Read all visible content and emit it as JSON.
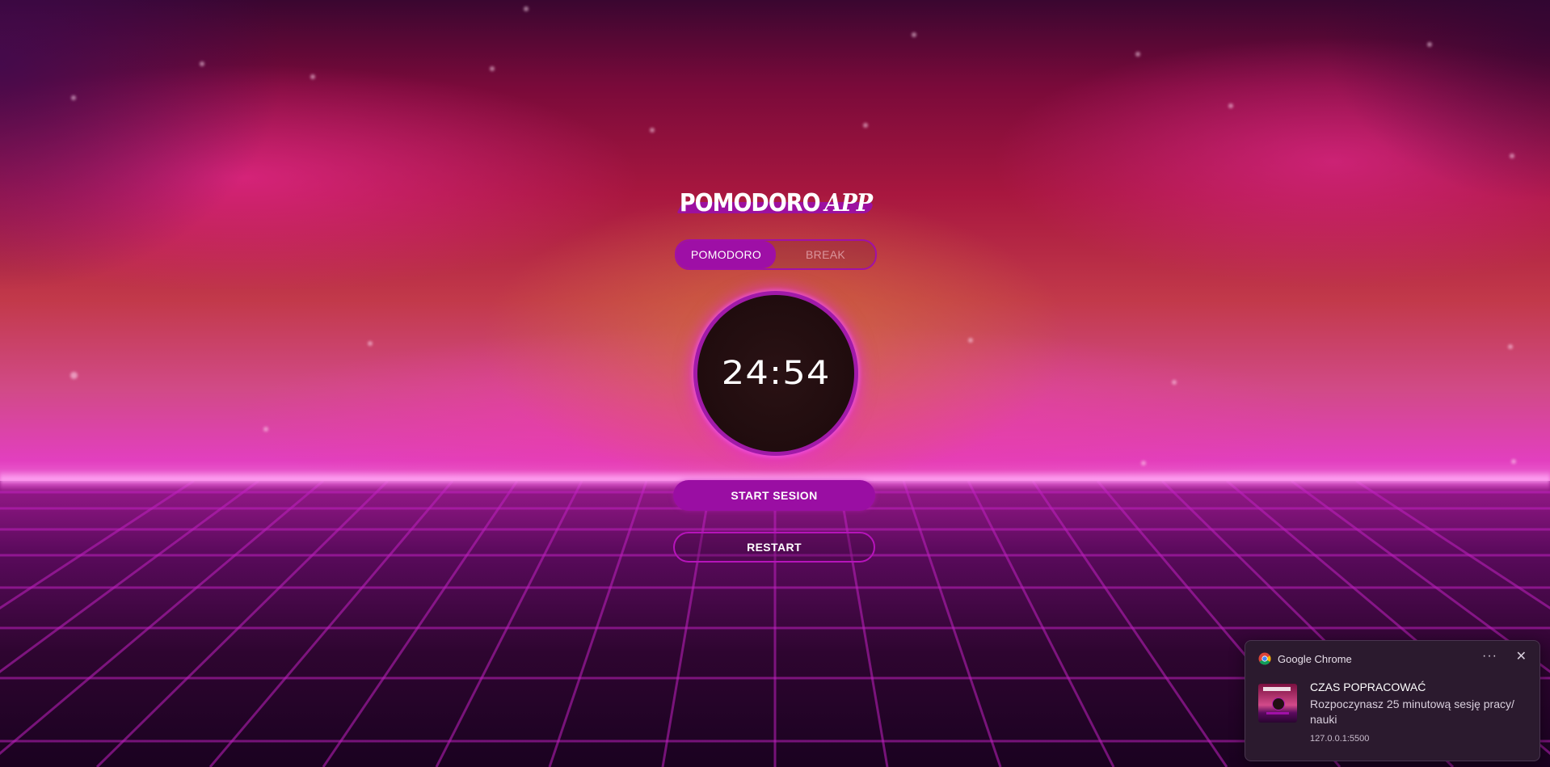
{
  "app": {
    "logo_main": "POMODORO",
    "logo_accent": "APP",
    "modes": [
      {
        "label": "POMODORO",
        "active": true
      },
      {
        "label": "BREAK",
        "active": false
      }
    ],
    "timer": "24:54",
    "start_button": "START SESION",
    "restart_button": "RESTART"
  },
  "notification": {
    "app_name": "Google Chrome",
    "more_icon": "more-horizontal-icon",
    "close_icon": "close-icon",
    "title": "CZAS POPRACOWAĆ",
    "message": "Rozpoczynasz 25 minutową sesję pracy/ nauki",
    "origin": "127.0.0.1:5500"
  },
  "colors": {
    "accent": "#9e0fa6",
    "ring": "#a01aa8",
    "timer_face": "#200c0e",
    "toast_bg": "#2b1a2e"
  }
}
